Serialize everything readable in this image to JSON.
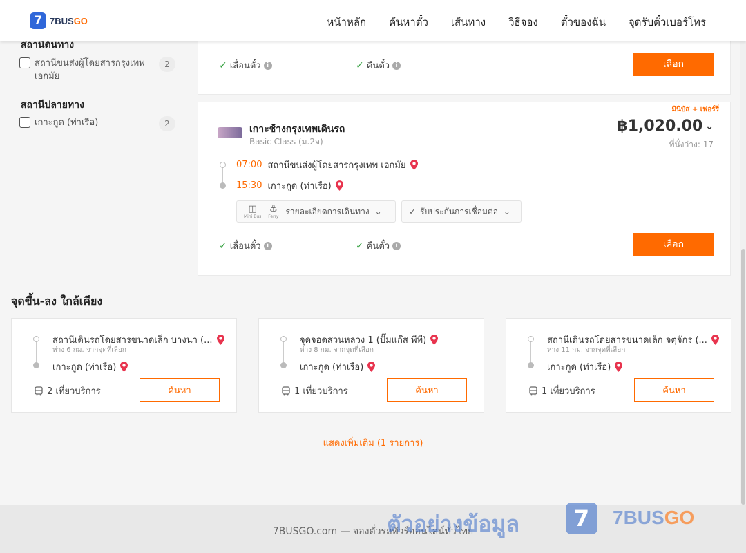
{
  "header": {
    "logo_mark": "7",
    "logo_text_main": "7BUS",
    "logo_text_accent": "GO",
    "nav": [
      "หน้าหลัก",
      "ค้นหาตั๋ว",
      "เส้นทาง",
      "วิธีจอง",
      "ตั๋วของฉัน",
      "จุดรับตั๋วเบอร์โทร"
    ]
  },
  "filters": {
    "origin_title": "สถานีต้นทาง",
    "origin_items": [
      {
        "label": "สถานีขนส่งผู้โดยสารกรุงเทพ เอกมัย",
        "count": "2"
      }
    ],
    "dest_title": "สถานีปลายทาง",
    "dest_items": [
      {
        "label": "เกาะกูด (ท่าเรือ)",
        "count": "2"
      }
    ]
  },
  "card1": {
    "feature1": "เลื่อนตั๋ว",
    "feature2": "คืนตั๋ว",
    "select_label": "เลือก"
  },
  "card2": {
    "tag": "มินิบัส + เฟอร์รี่",
    "operator": "เกาะช้างกรุงเทพเดินรถ",
    "class": "Basic Class (ม.2จ)",
    "price": "฿1,020.00",
    "seats": "ที่นั่งว่าง: 17",
    "depart_time": "07:00",
    "depart_station": "สถานีขนส่งผู้โดยสารกรุงเทพ เอกมัย",
    "arrive_time": "15:30",
    "arrive_station": "เกาะกูด (ท่าเรือ)",
    "minibus_label": "Mini Bus",
    "ferry_label": "Ferry",
    "trip_details": "รายละเอียดการเดินทาง",
    "guarantee": "รับประกันการเชื่อมต่อ",
    "feature1": "เลื่อนตั๋ว",
    "feature2": "คืนตั๋ว",
    "select_label": "เลือก"
  },
  "nearby": {
    "title": "จุดขึ้น-ลง ใกล้เคียง",
    "cards": [
      {
        "from": "สถานีเดินรถโดยสารขนาดเล็ก บางนา (...",
        "dist": "ห่าง 6 กม. จากจุดที่เลือก",
        "to": "เกาะกูด (ท่าเรือ)",
        "trips": "2 เที่ยวบริการ",
        "button": "ค้นหา"
      },
      {
        "from": "จุดจอดสวนหลวง 1 (ปั๊มแก๊ส พีที)",
        "dist": "ห่าง 8 กม. จากจุดที่เลือก",
        "to": "เกาะกูด (ท่าเรือ)",
        "trips": "1 เที่ยวบริการ",
        "button": "ค้นหา"
      },
      {
        "from": "สถานีเดินรถโดยสารขนาดเล็ก จตุจักร (...",
        "dist": "ห่าง 11 กม. จากจุดที่เลือก",
        "to": "เกาะกูด (ท่าเรือ)",
        "trips": "1 เที่ยวบริการ",
        "button": "ค้นหา"
      }
    ],
    "show_more": "แสดงเพิ่มเติม (1 รายการ)"
  },
  "footer": {
    "text": "7BUSGO.com — จองตั๋วรถทัวร์ออนไลน์ทั่วไทย",
    "watermark": "ตัวอย่างข้อมูล",
    "watermark_mark": "7",
    "watermark_brand_main": "7BUS",
    "watermark_brand_accent": "GO"
  },
  "colors": {
    "accent": "#ff6a00",
    "brand_blue": "#2f67d9",
    "check_green": "#2e9e3a"
  }
}
